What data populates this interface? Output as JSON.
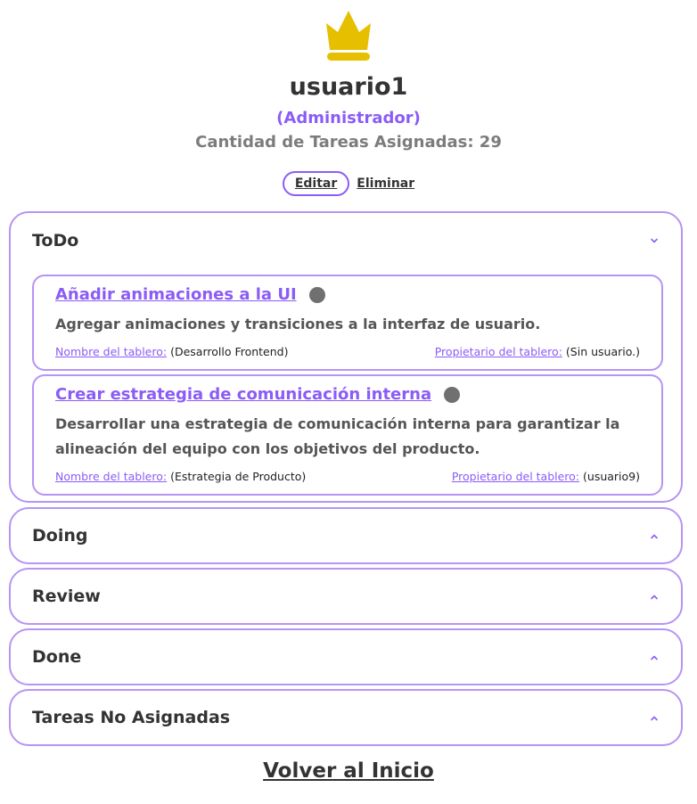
{
  "profile": {
    "icon": "crown-icon",
    "username": "usuario1",
    "role": "(Administrador)",
    "task_count": "Cantidad de Tareas Asignadas: 29",
    "edit_label": "Editar",
    "delete_label": "Eliminar"
  },
  "sections": {
    "todo": {
      "title": "ToDo",
      "expanded": true,
      "tasks": [
        {
          "title": "Añadir animaciones a la UI",
          "description": "Agregar animaciones y transiciones a la interfaz de usuario.",
          "board_label": "Nombre del tablero:",
          "board_value": "(Desarrollo Frontend)",
          "owner_label": "Propietario del tablero:",
          "owner_value": "(Sin usuario.)"
        },
        {
          "title": "Crear estrategia de comunicación interna",
          "description": "Desarrollar una estrategia de comunicación interna para garantizar la alineación del equipo con los objetivos del producto.",
          "board_label": "Nombre del tablero:",
          "board_value": "(Estrategia de Producto)",
          "owner_label": "Propietario del tablero:",
          "owner_value": "(usuario9)"
        }
      ]
    },
    "doing": {
      "title": "Doing",
      "expanded": false
    },
    "review": {
      "title": "Review",
      "expanded": false
    },
    "done": {
      "title": "Done",
      "expanded": false
    },
    "unassigned": {
      "title": "Tareas No Asignadas",
      "expanded": false
    }
  },
  "footer": {
    "back_label": "Volver al Inicio"
  },
  "colors": {
    "accent": "#8b5cf6",
    "border": "#b794f4",
    "crown": "#e6bf00",
    "status_dot": "#707070"
  }
}
